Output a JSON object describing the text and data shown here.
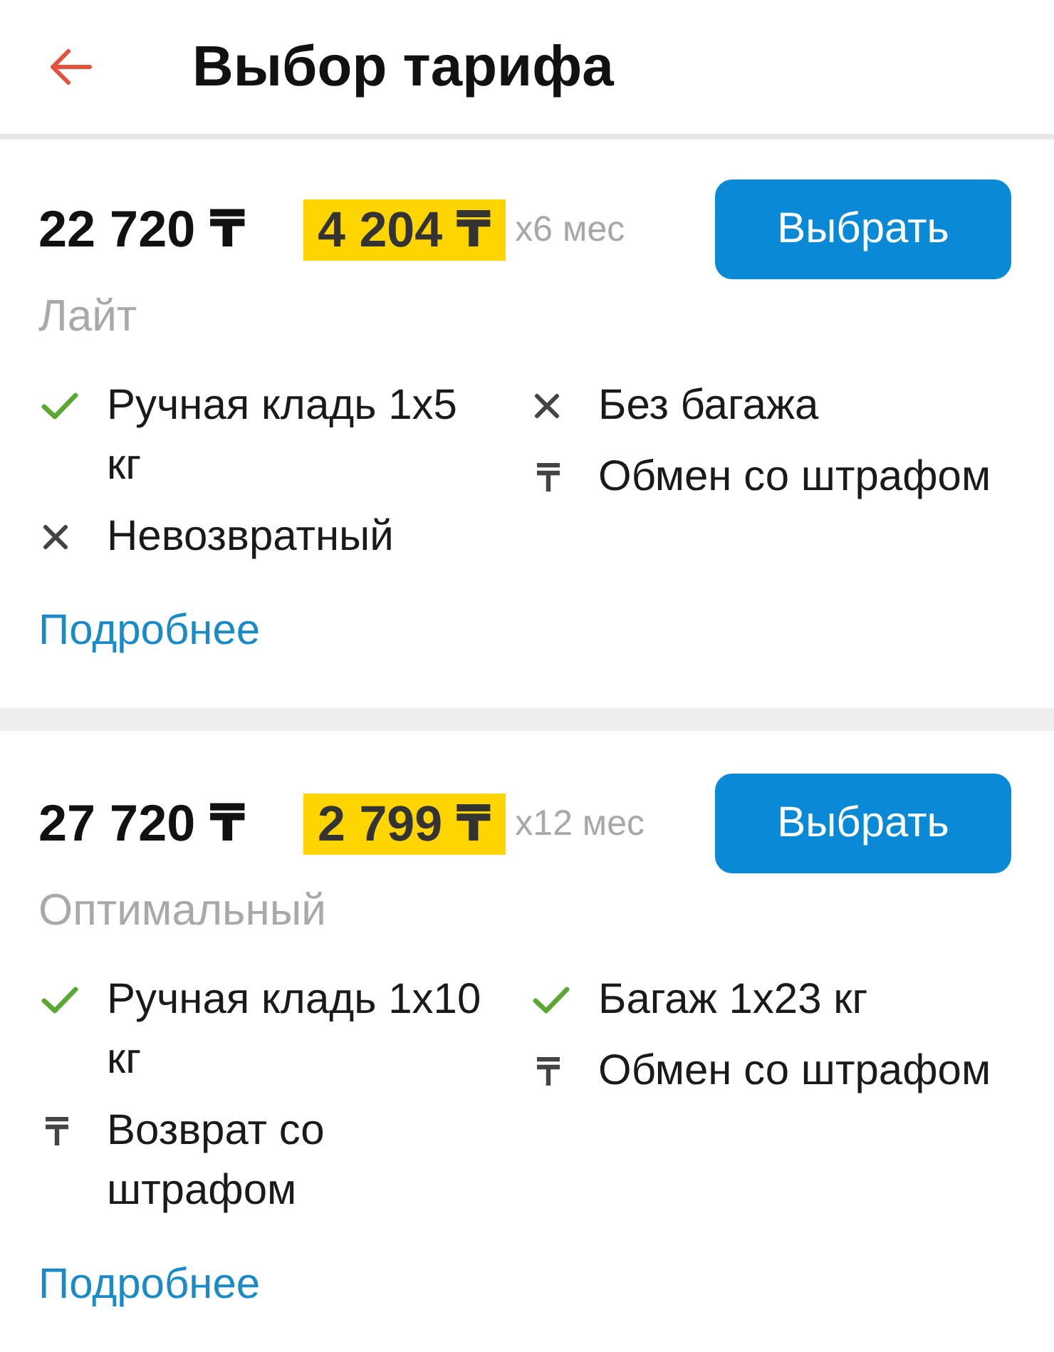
{
  "header": {
    "title": "Выбор тарифа"
  },
  "tariffs": [
    {
      "price": "22 720 ₸",
      "installment": "4 204 ₸",
      "installment_term": "x6 мес",
      "button": "Выбрать",
      "name": "Лайт",
      "feature_columns": [
        {
          "items": [
            {
              "kind": "included",
              "text": "Ручная кладь 1x5 кг"
            },
            {
              "kind": "excluded",
              "text": "Невозвратный"
            }
          ]
        },
        {
          "items": [
            {
              "kind": "excluded",
              "text": "Без багажа"
            },
            {
              "kind": "paid",
              "text": "Обмен со штрафом"
            }
          ]
        }
      ],
      "details_link": "Подробнее"
    },
    {
      "price": "27 720 ₸",
      "installment": "2 799 ₸",
      "installment_term": "x12 мес",
      "button": "Выбрать",
      "name": "Оптимальный",
      "feature_columns": [
        {
          "items": [
            {
              "kind": "included",
              "text": "Ручная кладь 1x10 кг"
            },
            {
              "kind": "paid",
              "text": "Возврат со штрафом"
            }
          ]
        },
        {
          "items": [
            {
              "kind": "included",
              "text": "Багаж 1x23 кг"
            },
            {
              "kind": "paid",
              "text": "Обмен со штрафом"
            }
          ]
        }
      ],
      "details_link": "Подробнее"
    }
  ]
}
